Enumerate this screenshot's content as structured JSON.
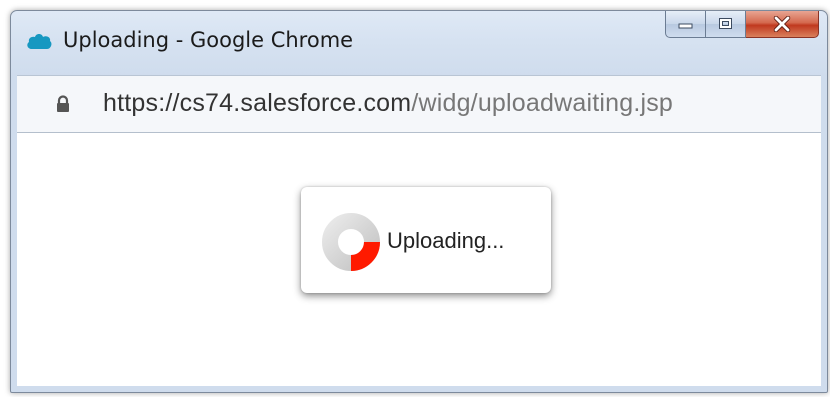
{
  "window": {
    "title": "Uploading - Google Chrome",
    "app_icon": "salesforce-cloud-icon",
    "caption_buttons": {
      "minimize_icon": "minimize-icon",
      "maximize_icon": "maximize-icon",
      "close_icon": "close-icon"
    }
  },
  "addressbar": {
    "security_icon": "lock-icon",
    "url_host": "https://cs74.salesforce.com",
    "url_path": "/widg/uploadwaiting.jsp"
  },
  "dialog": {
    "spinner_icon": "loading-spinner-icon",
    "message": "Uploading..."
  },
  "colors": {
    "spinner_track": "#d6d6d6",
    "spinner_active": "#ff1a00",
    "salesforce_blue": "#1798c1",
    "close_button": "#c7452a"
  }
}
